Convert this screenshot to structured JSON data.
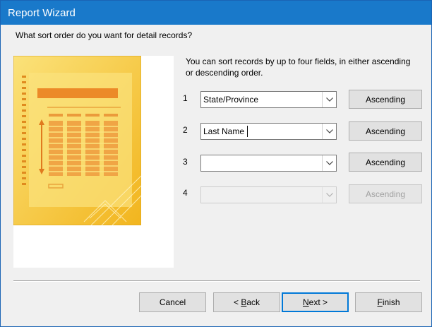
{
  "window": {
    "title": "Report Wizard"
  },
  "question": "What sort order do you want for detail records?",
  "instructions": "You can sort records by up to four fields, in either ascending or descending order.",
  "sort_rows": [
    {
      "number": "1",
      "field": "State/Province",
      "order": "Ascending",
      "enabled": true
    },
    {
      "number": "2",
      "field": "Last Name",
      "order": "Ascending",
      "enabled": true
    },
    {
      "number": "3",
      "field": "",
      "order": "Ascending",
      "enabled": true
    },
    {
      "number": "4",
      "field": "",
      "order": "Ascending",
      "enabled": false
    }
  ],
  "buttons": {
    "cancel": "Cancel",
    "back_prefix": "< ",
    "back_accel": "B",
    "back_rest": "ack",
    "next_accel": "N",
    "next_rest": "ext >",
    "finish_accel": "F",
    "finish_rest": "inish"
  },
  "colors": {
    "titlebar": "#1979ca",
    "illustration": "#f5c842",
    "default_button_border": "#0078d7"
  }
}
